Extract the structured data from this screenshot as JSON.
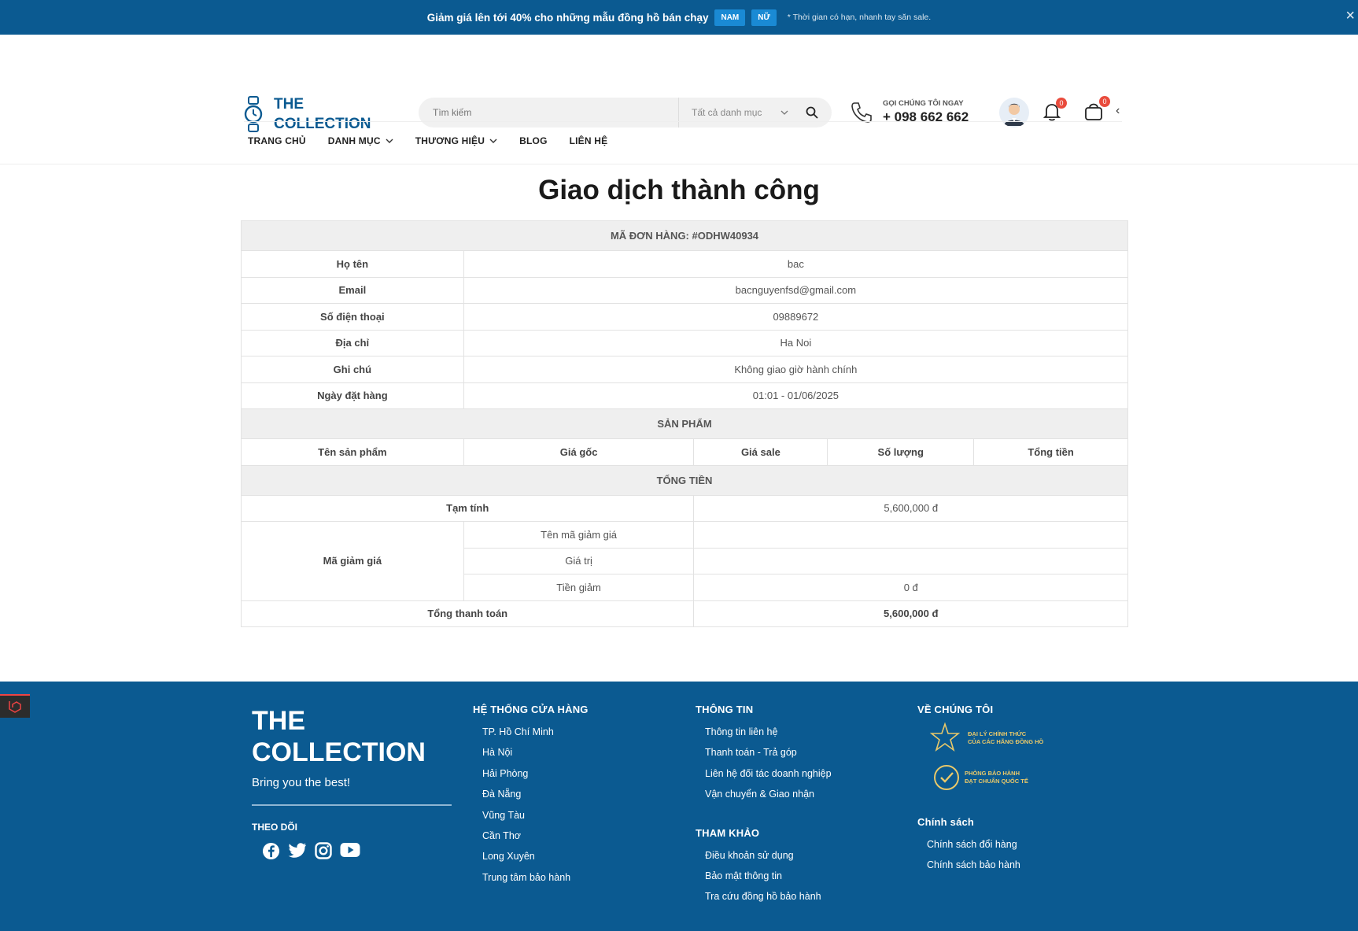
{
  "topbar": {
    "promo_prefix": "Giảm giá lên tới ",
    "promo_percent": "40%",
    "promo_suffix": " cho những mẫu đồng hồ bán chạy",
    "tag_male": "NAM",
    "tag_female": "NỮ",
    "note": "* Thời gian có hạn, nhanh tay săn sale.",
    "close": "×"
  },
  "header": {
    "logo_line1": "THE",
    "logo_line2": "COLLECTION",
    "search_placeholder": "Tìm kiếm",
    "category_select": "Tất cả danh mục",
    "phone_label": "GỌI CHÚNG TÔI NGAY",
    "phone_number": "+ 098 662 662",
    "notification_count": "0",
    "cart_count": "0"
  },
  "nav": {
    "items": [
      {
        "label": "TRANG CHỦ"
      },
      {
        "label": "DANH MỤC"
      },
      {
        "label": "THƯƠNG HIỆU"
      },
      {
        "label": "BLOG"
      },
      {
        "label": "LIÊN HỆ"
      }
    ]
  },
  "page": {
    "title": "Giao dịch thành công"
  },
  "order": {
    "code_label": "MÃ ĐƠN HÀNG: #ODHW40934",
    "fields": [
      {
        "label": "Họ tên",
        "value": "bac"
      },
      {
        "label": "Email",
        "value": "bacnguyenfsd@gmail.com"
      },
      {
        "label": "Số điện thoại",
        "value": "09889672"
      },
      {
        "label": "Địa chỉ",
        "value": "Ha Noi"
      },
      {
        "label": "Ghi chú",
        "value": "Không giao giờ hành chính"
      },
      {
        "label": "Ngày đặt hàng",
        "value": "01:01 - 01/06/2025"
      }
    ],
    "products_header": "SẢN PHẨM",
    "product_columns": [
      "Tên sản phẩm",
      "Giá gốc",
      "Giá sale",
      "Số lượng",
      "Tổng tiền"
    ],
    "total_header": "TỔNG TIỀN",
    "subtotal_label": "Tạm tính",
    "subtotal_value": "5,600,000 đ",
    "coupon_label": "Mã giảm giá",
    "coupon_name_label": "Tên mã giảm giá",
    "coupon_name_value": "",
    "coupon_value_label": "Giá trị",
    "coupon_value_value": "",
    "coupon_discount_label": "Tiền giảm",
    "coupon_discount_value": "0 đ",
    "grand_total_label": "Tổng thanh toán",
    "grand_total_value": "5,600,000 đ"
  },
  "footer": {
    "logo_line1": "THE",
    "logo_line2": "COLLECTION",
    "slogan": "Bring you the best!",
    "follow_label": "THEO DÕI",
    "stores_title": "HỆ THỐNG CỬA HÀNG",
    "stores": [
      "TP. Hồ Chí Minh",
      "Hà Nội",
      "Hải Phòng",
      "Đà Nẵng",
      "Vũng Tàu",
      "Cần Thơ",
      "Long Xuyên",
      "Trung tâm bảo hành"
    ],
    "info_title": "THÔNG TIN",
    "info": [
      "Thông tin liên hệ",
      "Thanh toán - Trả góp",
      "Liên hệ đối tác doanh nghiệp",
      "Vận chuyển & Giao nhận"
    ],
    "ref_title": "THAM KHẢO",
    "ref": [
      "Điều khoản sử dụng",
      "Bảo mật thông tin",
      "Tra cứu đồng hồ bảo hành"
    ],
    "about_title": "VỀ CHÚNG TÔI",
    "badge1_line1": "ĐẠI LÝ CHÍNH THỨC",
    "badge1_line2": "CỦA CÁC HÃNG ĐỒNG HỒ",
    "badge2_line1": "PHÒNG BẢO HÀNH",
    "badge2_line2": "ĐẠT CHUẨN QUỐC TẾ",
    "policy_title": "Chính sách",
    "policies": [
      "Chính sách đổi hàng",
      "Chính sách bảo hành"
    ]
  }
}
